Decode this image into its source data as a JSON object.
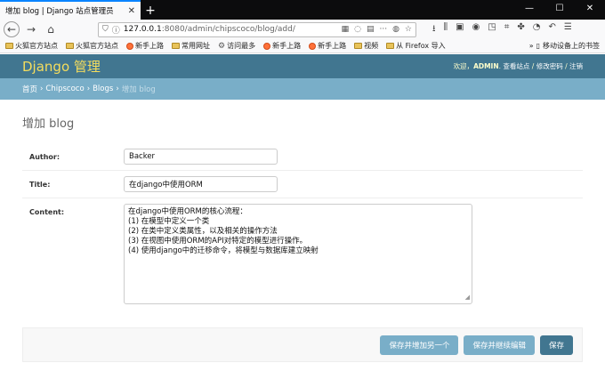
{
  "browser": {
    "tab_title": "增加 blog | Django 站点管理员",
    "tab_close": "✕",
    "new_tab": "+",
    "url_host": "127.0.0.1",
    "url_rest": ":8080/admin/chipscoco/blog/add/",
    "url_more": "···",
    "window_min": "—",
    "window_max": "☐",
    "window_close": "✕"
  },
  "bookmarks": [
    {
      "label": "火狐官方站点",
      "icon": "folder-icon"
    },
    {
      "label": "火狐官方站点",
      "icon": "folder-icon"
    },
    {
      "label": "新手上路",
      "icon": "firefox-icon"
    },
    {
      "label": "常用网址",
      "icon": "folder-icon"
    },
    {
      "label": "访问最多",
      "icon": "gear-icon"
    },
    {
      "label": "新手上路",
      "icon": "firefox-icon"
    },
    {
      "label": "新手上路",
      "icon": "firefox-icon"
    },
    {
      "label": "视频",
      "icon": "folder-icon"
    },
    {
      "label": "从 Firefox 导入",
      "icon": "folder-icon"
    }
  ],
  "bookmarks_right": "移动设备上的书签",
  "django": {
    "brand": "Django 管理",
    "welcome": "欢迎，",
    "user": "ADMIN",
    "view_site": "查看站点",
    "sep": " / ",
    "change_password": "修改密码",
    "logout": "注销",
    "breadcrumbs": [
      "首页",
      "Chipscoco",
      "Blogs",
      "增加 blog"
    ],
    "crumb_sep": "›"
  },
  "form": {
    "title": "增加 blog",
    "author_label": "Author:",
    "author_value": "Backer",
    "title_label": "Title:",
    "title_value": "在django中使用ORM",
    "content_label": "Content:",
    "content_lines": [
      "在django中使用ORM的核心流程：",
      "(1) 在模型中定义一个类",
      "(2) 在类中定义类属性，以及相关的操作方法",
      "(3) 在视图中使用ORM的API对特定的模型进行操作。",
      "(4) 使用django中的迁移命令，将模型与数据库建立映射"
    ]
  },
  "buttons": {
    "save_add_another": "保存并增加另一个",
    "save_continue": "保存并继续编辑",
    "save": "保存"
  },
  "colors": {
    "header_bg": "#417690",
    "breadcrumb_bg": "#79aec8",
    "brand": "#f5dd5d"
  }
}
